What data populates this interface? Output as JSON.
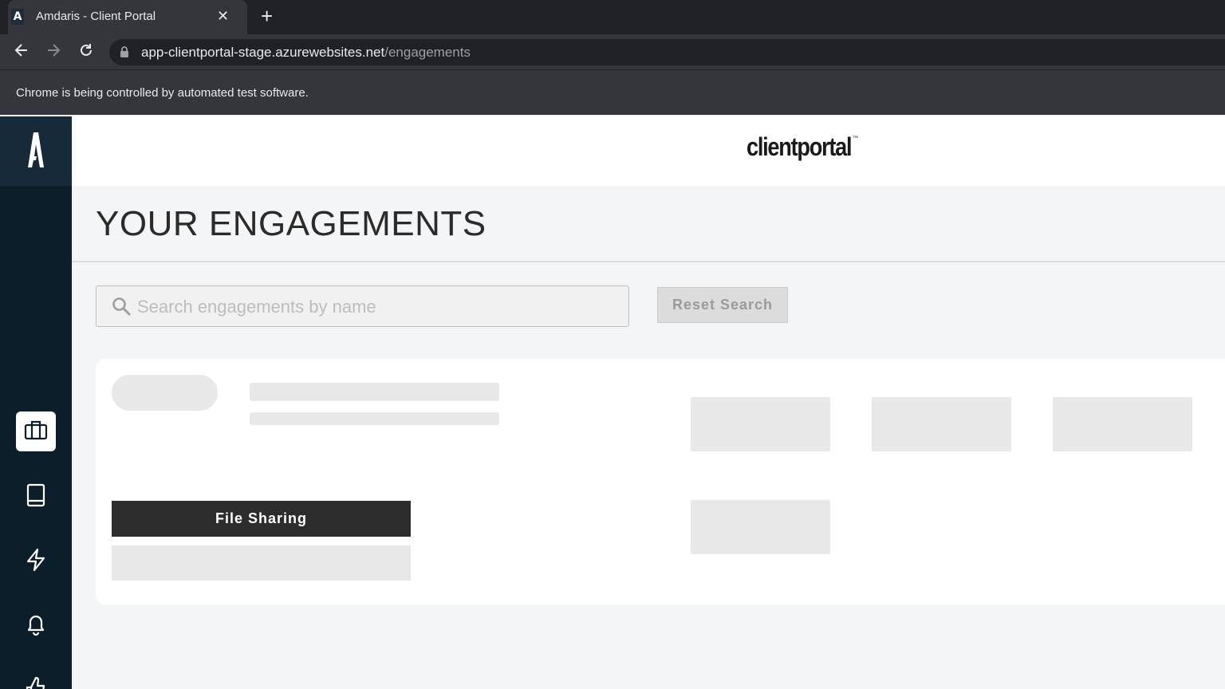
{
  "browser": {
    "tab_title": "Amdaris - Client Portal",
    "tab_favicon_letter": "A",
    "tab_close": "✕",
    "new_tab": "+",
    "url_host": "app-clientportal-stage.azurewebsites.net",
    "url_path": "/engagements",
    "infobar_text": "Chrome is being controlled by automated test software."
  },
  "header": {
    "brand": "clientportal",
    "brand_tm": "™"
  },
  "main": {
    "page_title": "YOUR ENGAGEMENTS",
    "search_placeholder": "Search engagements by name",
    "reset_label": "Reset Search",
    "file_sharing_label": "File Sharing"
  },
  "sidebar": {
    "items": [
      {
        "icon": "briefcase-icon",
        "active": true
      },
      {
        "icon": "book-icon",
        "active": false
      },
      {
        "icon": "lightning-icon",
        "active": false
      },
      {
        "icon": "bell-icon",
        "active": false
      },
      {
        "icon": "thumbs-up-icon",
        "active": false
      }
    ]
  },
  "colors": {
    "sidebar_bg": "#0d1e2b",
    "page_bg": "#f4f5f7",
    "skeleton": "#e8e8e8",
    "primary_button": "#2d2d2d"
  }
}
